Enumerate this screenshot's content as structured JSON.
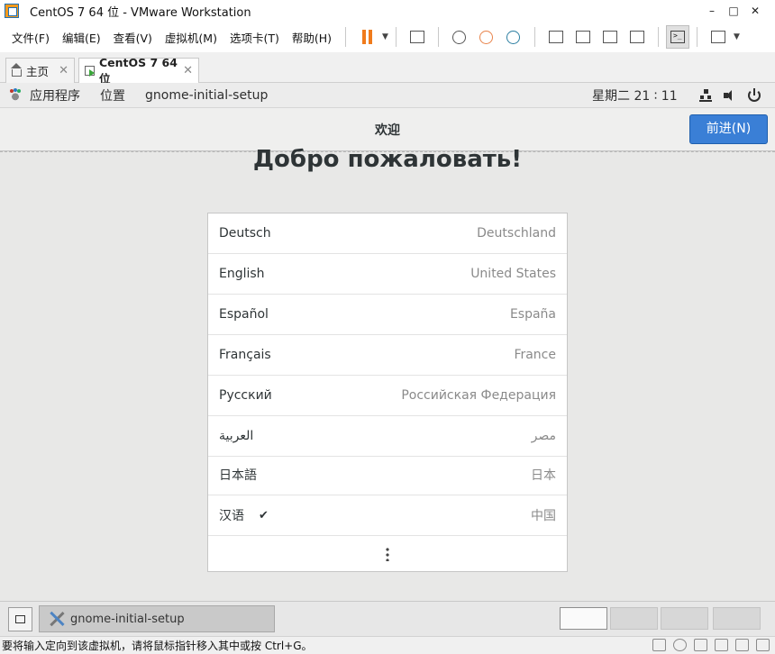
{
  "window": {
    "title": "CentOS 7 64 位 - VMware Workstation",
    "controls": [
      "–",
      "□",
      "✕"
    ]
  },
  "menu": [
    "文件(F)",
    "编辑(E)",
    "查看(V)",
    "虚拟机(M)",
    "选项卡(T)",
    "帮助(H)"
  ],
  "toolbar": {
    "dropdown_caret": "▼",
    "console_glyph": ">_"
  },
  "tabs": [
    {
      "label": "主页",
      "close": "✕"
    },
    {
      "label": "CentOS 7 64 位",
      "close": "✕"
    }
  ],
  "gnome": {
    "apps_label": "应用程序",
    "places_label": "位置",
    "active_app": "gnome-initial-setup",
    "clock": "星期二  21 ∶ 11"
  },
  "setup": {
    "header_title": "欢迎",
    "next_button": "前进(N)",
    "welcome_heading": "Добро пожаловать!",
    "more_icon": "view-more-icon",
    "languages": [
      {
        "name": "Deutsch",
        "country": "Deutschland",
        "selected": false
      },
      {
        "name": "English",
        "country": "United States",
        "selected": false
      },
      {
        "name": "Español",
        "country": "España",
        "selected": false
      },
      {
        "name": "Français",
        "country": "France",
        "selected": false
      },
      {
        "name": "Русский",
        "country": "Российская Федерация",
        "selected": false
      },
      {
        "name": "العربية",
        "country": "مصر",
        "selected": false
      },
      {
        "name": "日本語",
        "country": "日本",
        "selected": false
      },
      {
        "name": "汉语",
        "country": "中国",
        "selected": true,
        "check": "✔"
      }
    ]
  },
  "taskbar": {
    "window_button": "gnome-initial-setup",
    "workspaces": 4,
    "active_workspace": 1
  },
  "statusbar": {
    "text": "要将输入定向到该虚拟机，请将鼠标指针移入其中或按 Ctrl+G。"
  },
  "colors": {
    "accent_button": "#3a7fd6",
    "pause_orange": "#f07b1c"
  }
}
